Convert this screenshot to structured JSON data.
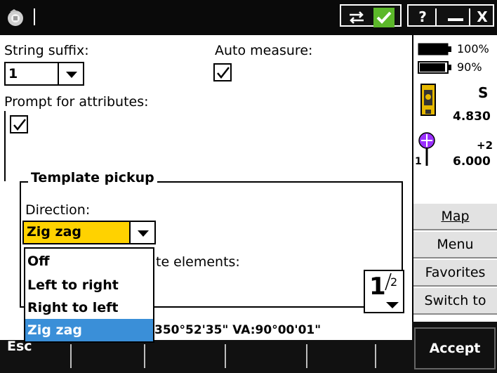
{
  "titlebar": {
    "help_label": "?",
    "minimize_label": "—",
    "close_label": "X"
  },
  "form": {
    "string_suffix_label": "String suffix:",
    "string_suffix_value": "1",
    "auto_measure_label": "Auto measure:",
    "auto_measure_checked": true,
    "prompt_attributes_label": "Prompt for attributes:",
    "prompt_attributes_checked": true
  },
  "template_pickup": {
    "title": "Template pickup",
    "direction_label": "Direction:",
    "direction_value": "Zig zag",
    "partial_label": "te elements:",
    "options": [
      "Off",
      "Left to right",
      "Right to left",
      "Zig zag"
    ],
    "selected_index": 3
  },
  "page_indicator": {
    "current": "1",
    "total": "2"
  },
  "status": {
    "text": "350°52'35\"  VA:90°00'01\""
  },
  "right_panel": {
    "battery1": "100%",
    "battery2": "90%",
    "instrument_letter": "S",
    "instrument_value": "4.830",
    "target_offset": "+2",
    "target_value": "6.000",
    "target_number": "1",
    "buttons": [
      {
        "label": "Map",
        "underline": "M"
      },
      {
        "label": "Menu",
        "underline": "e"
      },
      {
        "label": "Favorites",
        "underline": "a"
      },
      {
        "label": "Switch to",
        "underline": "w"
      }
    ]
  },
  "bottom_bar": {
    "esc_label": "Esc",
    "accept_label": "Accept"
  },
  "colors": {
    "dropdown_highlight": "#3a8fd8",
    "combo_highlight": "#ffd200",
    "titlebar_green": "#5cb82a",
    "bar_bg": "#111111"
  }
}
